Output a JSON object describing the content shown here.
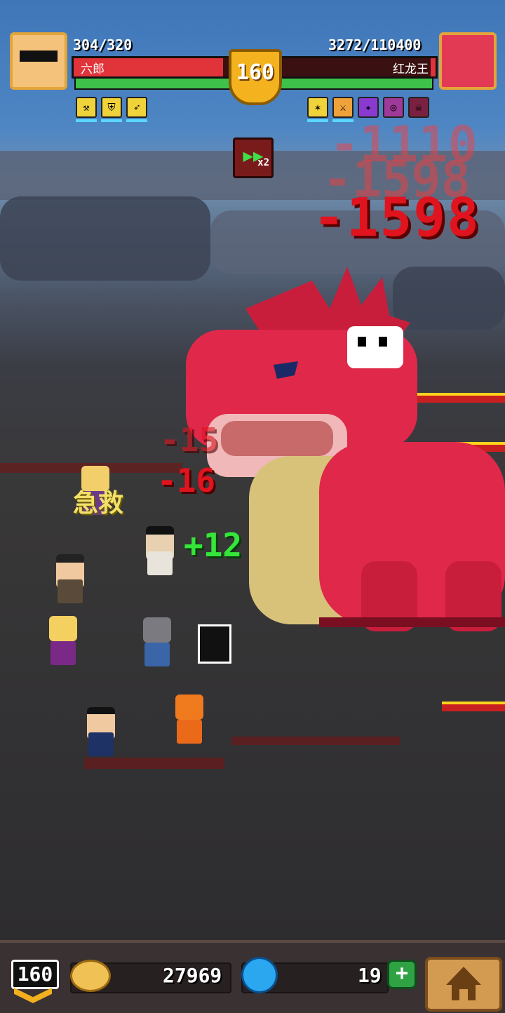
{
  "player": {
    "name": "六郎",
    "hp_text": "304/320",
    "hp_fraction": 0.95,
    "gauge_fraction": 1.0,
    "buff_icons": [
      "axe-icon",
      "shield-icon",
      "boot-icon"
    ]
  },
  "boss": {
    "name": "红龙王",
    "hp_text": "3272/110400",
    "hp_fraction": 0.03,
    "gauge_fraction": 1.0,
    "buff_icons": [
      "fire-icon",
      "claw-icon",
      "sword-icon",
      "spiral-icon",
      "skull-icon"
    ]
  },
  "stage_level": "160",
  "speed": {
    "icon": "fast-forward-icon",
    "label": "x2"
  },
  "damage_numbers": {
    "big_1": "-1598",
    "ghost_1": "-1110",
    "ghost_2": "-1598",
    "small_1": "-15",
    "small_2": "-16"
  },
  "heal_number": "+12",
  "status_text": "急救",
  "bottom_bar": {
    "level": "160",
    "gold": "27969",
    "gems": "19",
    "plus_label": "+",
    "home_icon": "home-icon"
  },
  "colors": {
    "hp_red": "#e0333a",
    "gauge_green": "#3ec24a",
    "dragon_red": "#e0284a",
    "gold": "#f4b21f"
  }
}
